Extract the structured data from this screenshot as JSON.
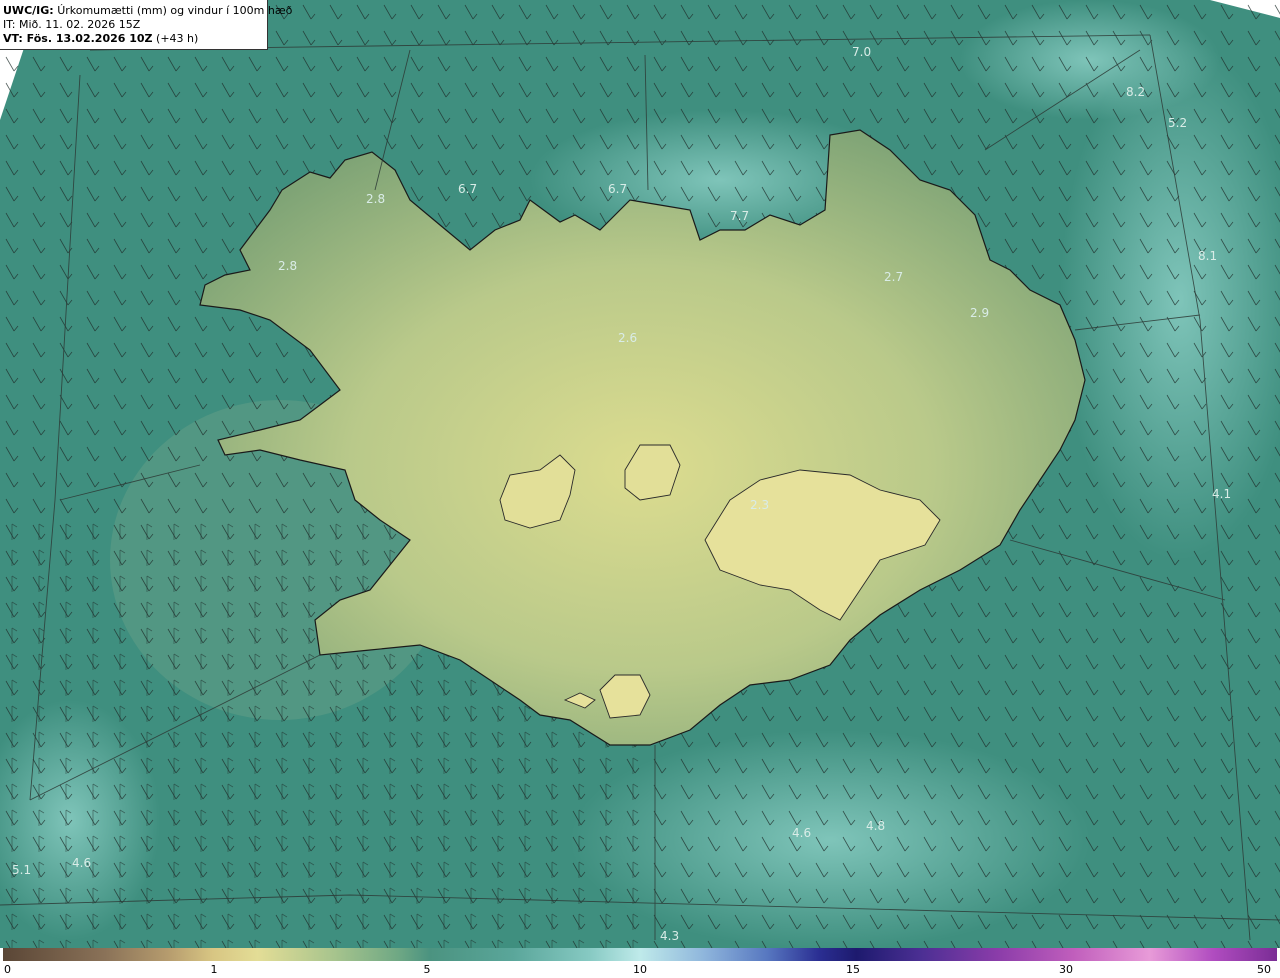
{
  "header": {
    "model": "UWC/IG:",
    "title": "Úrkomumætti (mm) og vindur í 100m hæð",
    "it_line": "IT: Mið. 11. 02. 2026 15Z",
    "vt_bold": "VT: Fös. 13.02.2026 10Z",
    "vt_lead": "(+43 h)"
  },
  "map": {
    "values": [
      {
        "label": "7.0"
      },
      {
        "label": "8.2"
      },
      {
        "label": "5.2"
      },
      {
        "label": "6.7"
      },
      {
        "label": "6.7"
      },
      {
        "label": "7.7"
      },
      {
        "label": "2.8"
      },
      {
        "label": "2.8"
      },
      {
        "label": "2.7"
      },
      {
        "label": "8.1"
      },
      {
        "label": "2.9"
      },
      {
        "label": "2.6"
      },
      {
        "label": "4.1"
      },
      {
        "label": "2.3"
      },
      {
        "label": "4.6"
      },
      {
        "label": "4.8"
      },
      {
        "label": "5.1"
      },
      {
        "label": "4.6"
      },
      {
        "label": "4.3"
      }
    ],
    "colors": {
      "ocean": "#3f8f7f",
      "ocean_light": "#7cc6bd",
      "land_low": "#86a96f",
      "land_high": "#d9dc8f",
      "coast": "#1a1a1a",
      "grid": "#333333"
    }
  },
  "legend": {
    "ticks": [
      "0",
      "1",
      "5",
      "10",
      "15",
      "30",
      "50"
    ]
  }
}
